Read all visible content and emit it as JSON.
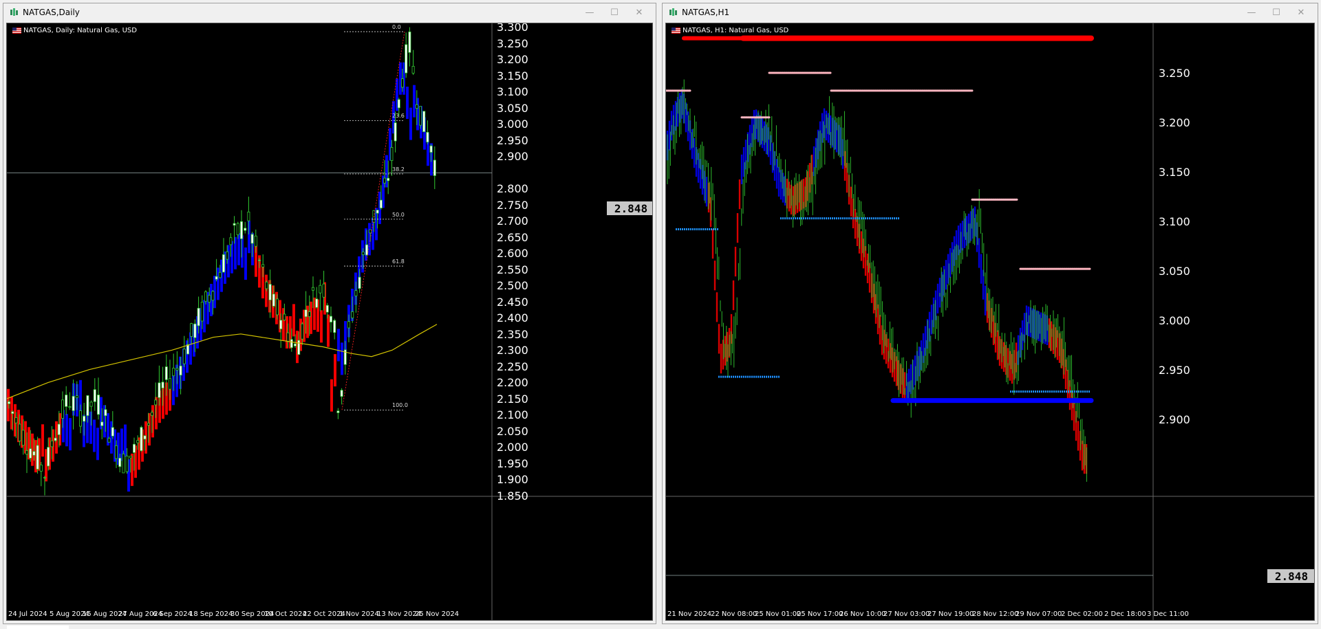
{
  "windows": [
    {
      "title": "NATGAS,Daily",
      "symbol_label": "NATGAS, Daily:  Natural Gas, USD",
      "current_price": "2.848",
      "y_ticks": [
        "3.300",
        "3.250",
        "3.200",
        "3.150",
        "3.100",
        "3.050",
        "3.000",
        "2.950",
        "2.900",
        "2.800",
        "2.750",
        "2.700",
        "2.650",
        "2.600",
        "2.550",
        "2.500",
        "2.450",
        "2.400",
        "2.350",
        "2.300",
        "2.250",
        "2.200",
        "2.150",
        "2.100",
        "2.050",
        "2.000",
        "1.950",
        "1.900",
        "1.850"
      ],
      "x_ticks": [
        "24 Jul 2024",
        "5 Aug 2024",
        "15 Aug 2024",
        "27 Aug 2024",
        "6 Sep 2024",
        "18 Sep 2024",
        "30 Sep 2024",
        "10 Oct 2024",
        "22 Oct 2024",
        "1 Nov 2024",
        "13 Nov 2024",
        "25 Nov 2024"
      ],
      "fib_levels": [
        "0.0",
        "23.6",
        "38.2",
        "50.0",
        "61.8",
        "100.0"
      ]
    },
    {
      "title": "NATGAS,H1",
      "symbol_label": "NATGAS, H1:  Natural Gas, USD",
      "current_price": "2.848",
      "y_ticks": [
        "3.250",
        "3.200",
        "3.150",
        "3.100",
        "3.050",
        "3.000",
        "2.950",
        "2.900"
      ],
      "x_ticks": [
        "21 Nov 2024",
        "22 Nov 08:00",
        "25 Nov 01:00",
        "25 Nov 17:00",
        "26 Nov 10:00",
        "27 Nov 03:00",
        "27 Nov 19:00",
        "28 Nov 12:00",
        "29 Nov 07:00",
        "2 Dec 02:00",
        "2 Dec 18:00",
        "3 Dec 11:00"
      ]
    }
  ],
  "window_buttons": {
    "minimize": "—",
    "maximize": "☐",
    "close": "✕"
  },
  "colors": {
    "background": "#000000",
    "bull": "#32cd32",
    "bull_fill": "#ffffff",
    "trend_up": "#0000ff",
    "trend_down": "#ff0000",
    "ma": "#d4c400",
    "resistance": "#ffb6c1",
    "support": "#1e90ff"
  }
}
